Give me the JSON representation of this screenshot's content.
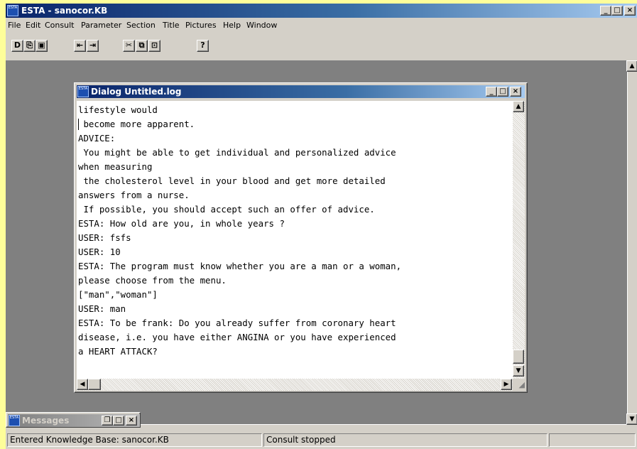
{
  "app": {
    "title": "ESTA - sanocor.KB",
    "icon": "esta-app-icon",
    "icon_text": "ESTA",
    "caption_buttons": {
      "minimize": "_",
      "maximize": "□",
      "close": "×"
    }
  },
  "menu": [
    "File",
    "Edit",
    "Consult",
    "Parameter",
    "Section",
    "Title",
    "Pictures",
    "Help",
    "Window"
  ],
  "toolbar": {
    "buttons": [
      {
        "name": "new-file-icon",
        "glyph": "D"
      },
      {
        "name": "open-file-icon",
        "glyph": "⎘"
      },
      {
        "name": "save-icon",
        "glyph": "▣"
      },
      {
        "name": "undo-icon",
        "glyph": "⇤"
      },
      {
        "name": "redo-icon",
        "glyph": "⇥"
      },
      {
        "name": "cut-icon",
        "glyph": "✂"
      },
      {
        "name": "copy-icon",
        "glyph": "⧉"
      },
      {
        "name": "paste-icon",
        "glyph": "⊡"
      },
      {
        "name": "help-icon",
        "glyph": "?"
      }
    ]
  },
  "dialog": {
    "title": "Dialog Untitled.log",
    "icon_text": "ESTA",
    "lines": [
      "lifestyle would",
      " become more apparent.",
      "ADVICE:",
      " You might be able to get individual and personalized advice",
      "when measuring",
      " the cholesterol level in your blood and get more detailed",
      "answers from a nurse.",
      " If possible, you should accept such an offer of advice.",
      "ESTA: How old are you, in whole years ?",
      "USER: fsfs",
      "USER: 10",
      "ESTA: The program must know whether you are a man or a woman,",
      "please choose from the menu.",
      "[\"man\",\"woman\"]",
      "USER: man",
      "ESTA: To be frank: Do you already suffer from coronary heart",
      "disease, i.e. you have either ANGINA or you have experienced",
      "a HEART ATTACK?"
    ]
  },
  "messages": {
    "title": "Messages",
    "icon_text": "ESTA"
  },
  "status": {
    "knowledge_base": "Entered Knowledge Base:  sanocor.KB",
    "consult_state": "Consult stopped"
  }
}
